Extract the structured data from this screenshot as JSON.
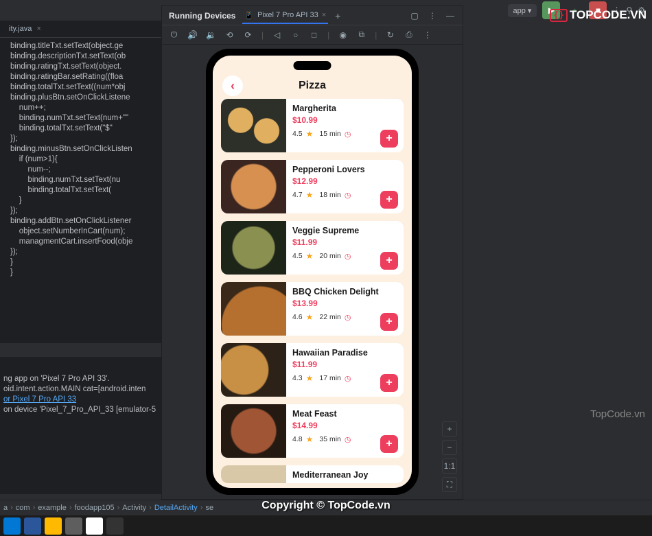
{
  "ide": {
    "toolbar": {
      "app_label": "app ▾"
    },
    "tab": {
      "name": "ity.java"
    },
    "code_lines": [
      "binding.titleTxt.setText(object.ge",
      "binding.descriptionTxt.setText(ob",
      "binding.ratingTxt.setText(object.",
      "binding.ratingBar.setRating((floa",
      "binding.totalTxt.setText((num*obj",
      "",
      "binding.plusBtn.setOnClickListene",
      "    num++;",
      "    binding.numTxt.setText(num+\"\"",
      "    binding.totalTxt.setText(\"$\" ",
      "",
      "});",
      "binding.minusBtn.setOnClickListen",
      "    if (num>1){",
      "        num--;",
      "        binding.numTxt.setText(nu",
      "        binding.totalTxt.setText(",
      "    }",
      "});",
      "binding.addBtn.setOnClickListener",
      "    object.setNumberInCart(num);",
      "    managmentCart.insertFood(obje",
      "});",
      "}",
      "",
      "}"
    ],
    "console_lines": [
      "ng app on 'Pixel 7 Pro API 33'.",
      "oid.intent.action.MAIN cat=[android.inten",
      "",
      "or Pixel 7 Pro API 33",
      "on device 'Pixel_7_Pro_API_33 [emulator-5"
    ],
    "breadcrumbs": [
      "a",
      "com",
      "example",
      "foodapp105",
      "Activity",
      "DetailActivity",
      "se"
    ]
  },
  "panel": {
    "title": "Running Devices",
    "device_tab": "Pixel 7 Pro API 33",
    "zoom": {
      "plus": "+",
      "minus": "−",
      "ratio": "1:1",
      "fit": "⛶"
    }
  },
  "app": {
    "title": "Pizza",
    "back_icon": "‹",
    "items": [
      {
        "name": "Margherita",
        "price": "$10.99",
        "rating": "4.5",
        "time": "15 min",
        "img": "pizza-bg-1"
      },
      {
        "name": "Pepperoni Lovers",
        "price": "$12.99",
        "rating": "4.7",
        "time": "18 min",
        "img": "pizza-bg-2"
      },
      {
        "name": "Veggie Supreme",
        "price": "$11.99",
        "rating": "4.5",
        "time": "20 min",
        "img": "pizza-bg-3"
      },
      {
        "name": "BBQ Chicken Delight",
        "price": "$13.99",
        "rating": "4.6",
        "time": "22 min",
        "img": "pizza-bg-4"
      },
      {
        "name": "Hawaiian Paradise",
        "price": "$11.99",
        "rating": "4.3",
        "time": "17 min",
        "img": "pizza-bg-5"
      },
      {
        "name": "Meat Feast",
        "price": "$14.99",
        "rating": "4.8",
        "time": "35 min",
        "img": "pizza-bg-6"
      },
      {
        "name": "Mediterranean Joy",
        "price": "",
        "rating": "",
        "time": "",
        "img": "pizza-bg-7"
      }
    ],
    "add_label": "+"
  },
  "watermark": {
    "brand": "TOPCODE.VN",
    "mid": "TopCode.vn",
    "copyright": "Copyright © TopCode.vn"
  }
}
